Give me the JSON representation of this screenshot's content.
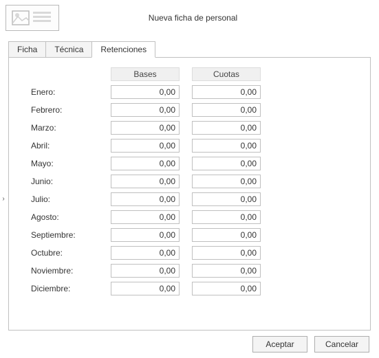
{
  "header": {
    "title": "Nueva ficha de personal"
  },
  "tabs": {
    "ficha": "Ficha",
    "tecnica": "Técnica",
    "retenciones": "Retenciones",
    "active": "Retenciones"
  },
  "columns": {
    "bases": "Bases",
    "cuotas": "Cuotas"
  },
  "rows": [
    {
      "label": "Enero:",
      "bases": "0,00",
      "cuotas": "0,00"
    },
    {
      "label": "Febrero:",
      "bases": "0,00",
      "cuotas": "0,00"
    },
    {
      "label": "Marzo:",
      "bases": "0,00",
      "cuotas": "0,00"
    },
    {
      "label": "Abril:",
      "bases": "0,00",
      "cuotas": "0,00"
    },
    {
      "label": "Mayo:",
      "bases": "0,00",
      "cuotas": "0,00"
    },
    {
      "label": "Junio:",
      "bases": "0,00",
      "cuotas": "0,00"
    },
    {
      "label": "Julio:",
      "bases": "0,00",
      "cuotas": "0,00"
    },
    {
      "label": "Agosto:",
      "bases": "0,00",
      "cuotas": "0,00"
    },
    {
      "label": "Septiembre:",
      "bases": "0,00",
      "cuotas": "0,00"
    },
    {
      "label": "Octubre:",
      "bases": "0,00",
      "cuotas": "0,00"
    },
    {
      "label": "Noviembre:",
      "bases": "0,00",
      "cuotas": "0,00"
    },
    {
      "label": "Diciembre:",
      "bases": "0,00",
      "cuotas": "0,00"
    }
  ],
  "buttons": {
    "accept": "Aceptar",
    "cancel": "Cancelar"
  },
  "collapse_glyph": "›"
}
